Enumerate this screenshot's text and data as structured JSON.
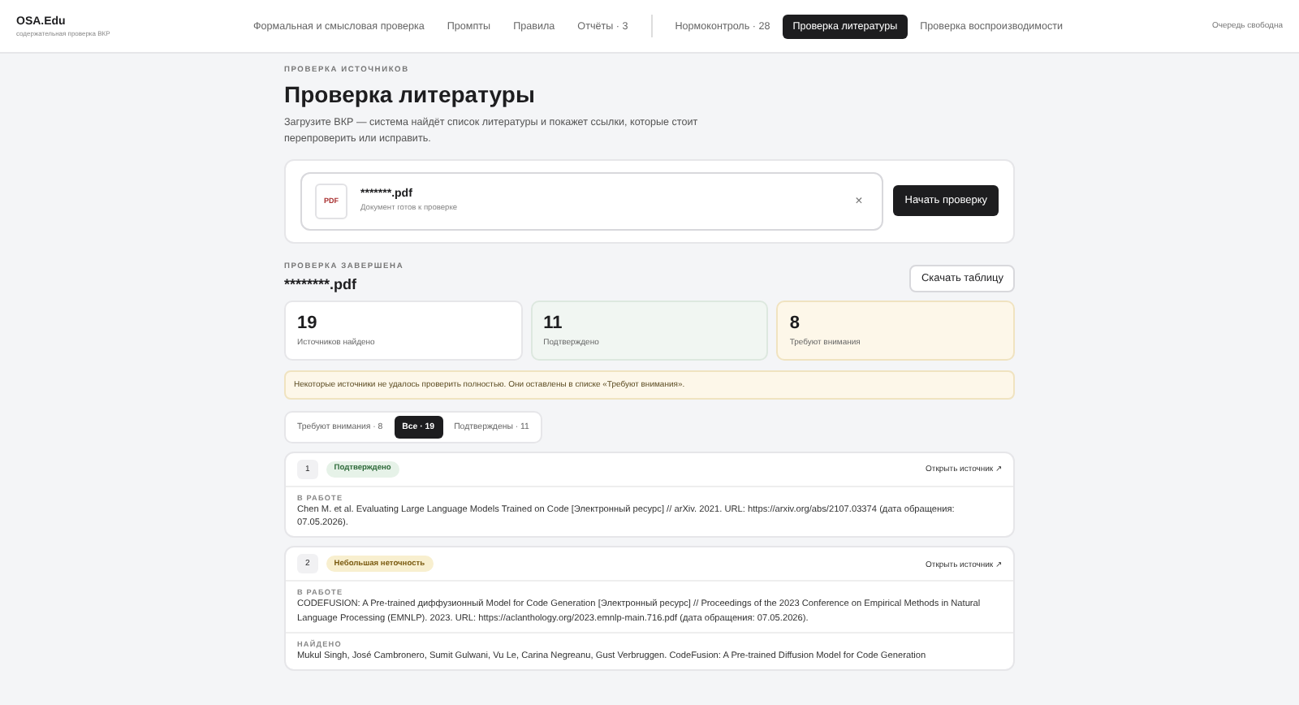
{
  "brand": {
    "name": "OSA.Edu",
    "tagline": "содержательная проверка ВКР"
  },
  "nav": [
    {
      "items": [
        {
          "label": "Формальная и смысловая проверка",
          "selected": false
        },
        {
          "label": "Промпты",
          "selected": false
        },
        {
          "label": "Правила",
          "selected": false
        },
        {
          "label": "Отчёты · 3",
          "selected": false
        }
      ]
    },
    {
      "items": [
        {
          "label": "Нормоконтроль · 28",
          "selected": false
        },
        {
          "label": "Проверка литературы",
          "selected": true
        },
        {
          "label": "Проверка воспроизводимости",
          "selected": false
        }
      ]
    }
  ],
  "queue_status": "Очередь свободна",
  "page": {
    "eyebrow": "ПРОВЕРКА ИСТОЧНИКОВ",
    "title": "Проверка литературы",
    "description": "Загрузите ВКР — система найдёт список литературы и покажет ссылки, которые стоит перепроверить или исправить."
  },
  "upload": {
    "file_badge": "PDF",
    "file_name": "*******.pdf",
    "file_status": "Документ готов к проверке",
    "remove": "×",
    "start_button": "Начать проверку"
  },
  "result": {
    "eyebrow": "ПРОВЕРКА ЗАВЕРШЕНА",
    "file_name": "********.pdf",
    "download_button": "Скачать таблицу"
  },
  "stats": [
    {
      "value": "19",
      "label": "Источников найдено",
      "kind": "total"
    },
    {
      "value": "11",
      "label": "Подтверждено",
      "kind": "ok"
    },
    {
      "value": "8",
      "label": "Требуют внимания",
      "kind": "warn"
    }
  ],
  "notice": "Некоторые источники не удалось проверить полностью. Они оставлены в списке «Требуют внимания».",
  "filters": [
    {
      "label": "Требуют внимания · 8",
      "selected": false
    },
    {
      "label": "Все · 19",
      "selected": true
    },
    {
      "label": "Подтверждены · 11",
      "selected": false
    }
  ],
  "sources": [
    {
      "number": "1",
      "status": "Подтверждено",
      "kind": "ok",
      "link": "Открыть источник ↗",
      "sections": [
        {
          "label": "В РАБОТЕ",
          "text": "Chen M. et al. Evaluating Large Language Models Trained on Code [Электронный ресурс] // arXiv. 2021. URL: https://arxiv.org/abs/2107.03374 (дата обращения: 07.05.2026)."
        }
      ]
    },
    {
      "number": "2",
      "status": "Небольшая неточность",
      "kind": "minor",
      "link": "Открыть источник ↗",
      "sections": [
        {
          "label": "В РАБОТЕ",
          "text": "CODEFUSION: A Pre-trained диффузионный Model for Code Generation [Электронный ресурс] // Proceedings of the 2023 Conference on Empirical Methods in Natural Language Processing (EMNLP). 2023. URL: https://aclanthology.org/2023.emnlp-main.716.pdf (дата обращения: 07.05.2026)."
        },
        {
          "label": "НАЙДЕНО",
          "text": "Mukul Singh, José Cambronero, Sumit Gulwani, Vu Le, Carina Negreanu, Gust Verbruggen. CodeFusion: A Pre-trained Diffusion Model for Code Generation"
        }
      ]
    }
  ]
}
